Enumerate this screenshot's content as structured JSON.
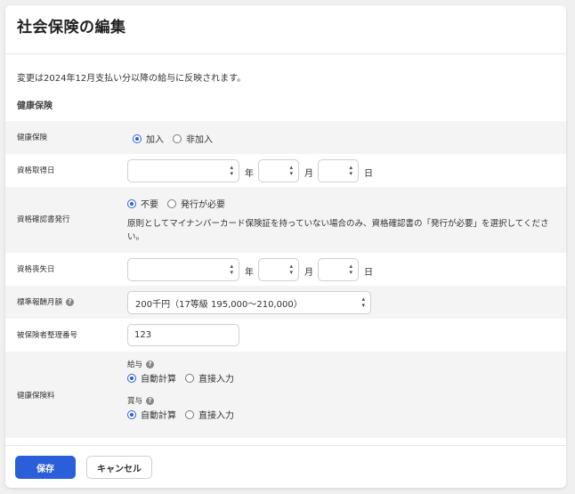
{
  "page": {
    "title": "社会保険の編集",
    "notice": "変更は2024年12月支払い分以降の給与に反映されます。",
    "section_title": "健康保険"
  },
  "rows": {
    "enrollment": {
      "label": "健康保険",
      "options": [
        "加入",
        "非加入"
      ],
      "selected": "加入"
    },
    "acquisition_date": {
      "label": "資格取得日",
      "year_value": "",
      "month_value": "",
      "day_value": "",
      "year_unit": "年",
      "month_unit": "月",
      "day_unit": "日"
    },
    "certificate": {
      "label": "資格確認書発行",
      "options": [
        "不要",
        "発行が必要"
      ],
      "selected": "不要",
      "note": "原則としてマイナンバーカード保険証を持っていない場合のみ、資格確認書の「発行が必要」を選択してください。"
    },
    "loss_date": {
      "label": "資格喪失日",
      "year_value": "",
      "month_value": "",
      "day_value": "",
      "year_unit": "年",
      "month_unit": "月",
      "day_unit": "日"
    },
    "standard_remuneration": {
      "label": "標準報酬月額",
      "value": "200千円（17等級 195,000〜210,000）"
    },
    "insured_number": {
      "label": "被保険者整理番号",
      "value": "123"
    },
    "premium": {
      "label": "健康保険料",
      "salary": {
        "label": "給与",
        "options": [
          "自動計算",
          "直接入力"
        ],
        "selected": "自動計算"
      },
      "bonus": {
        "label": "賞与",
        "options": [
          "自動計算",
          "直接入力"
        ],
        "selected": "自動計算"
      }
    }
  },
  "footer": {
    "save_label": "保存",
    "cancel_label": "キャンセル"
  },
  "colors": {
    "accent": "#2b5fd9",
    "row_shade": "#f4f4f4"
  },
  "icons": {
    "help": "question-circle-icon",
    "select_caret": "updown-caret-icon"
  }
}
